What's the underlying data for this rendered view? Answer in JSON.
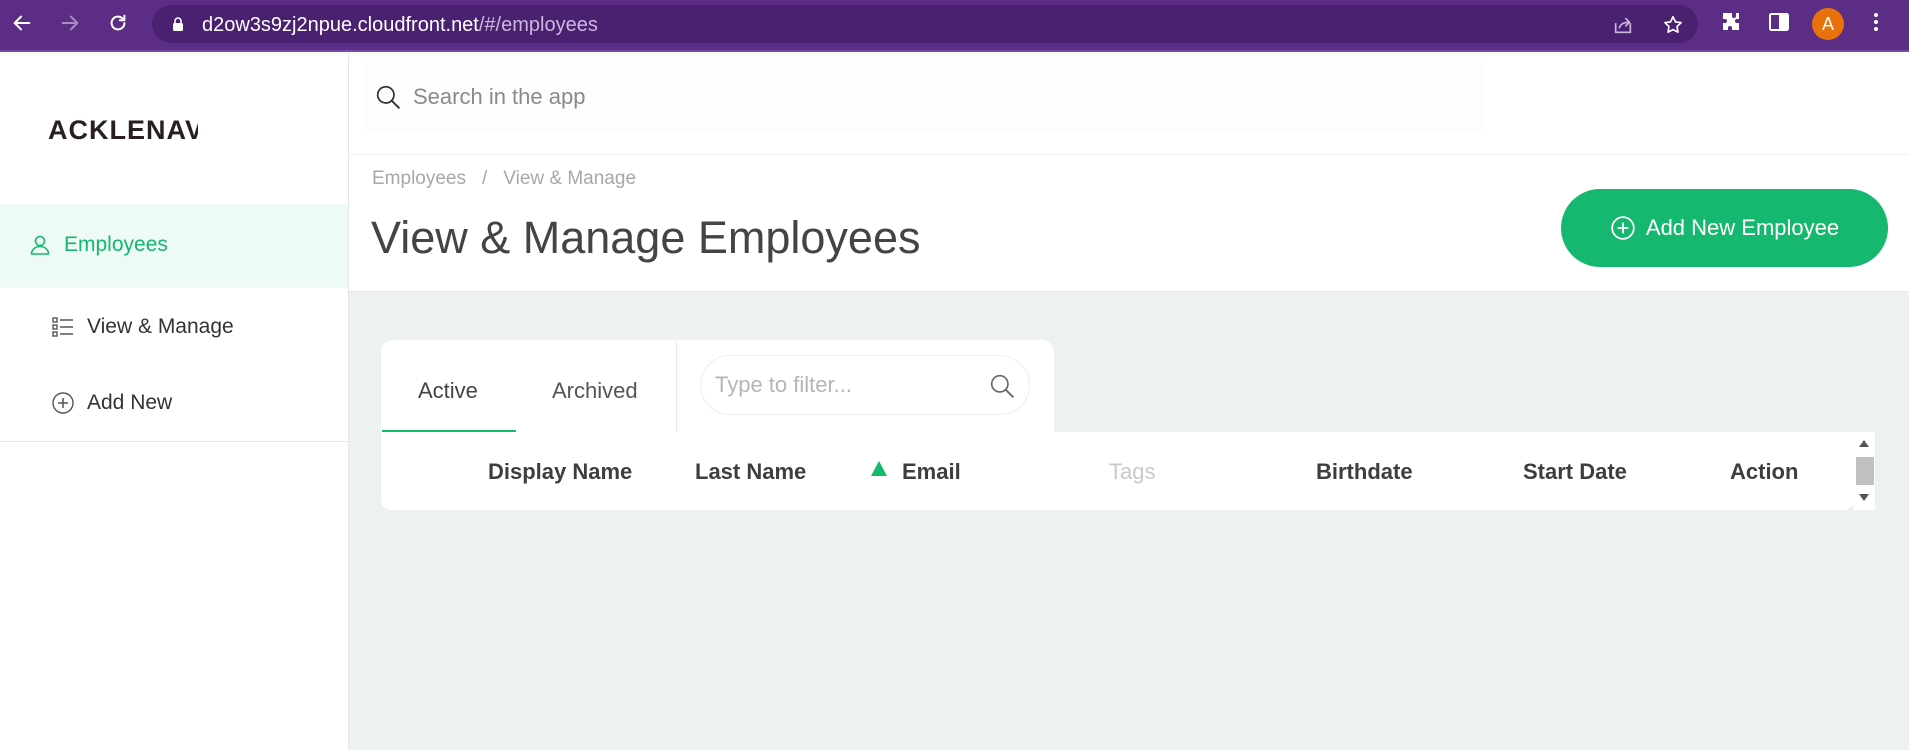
{
  "browser": {
    "url_host": "d2ow3s9zj2npue.cloudfront.net",
    "url_path": "/#/employees",
    "avatar_letter": "A",
    "accent_color": "#5c2d84"
  },
  "sidebar": {
    "logo": "ACKLENAV",
    "section_label": "Employees",
    "items": [
      {
        "label": "View & Manage",
        "icon": "list-icon"
      },
      {
        "label": "Add New",
        "icon": "plus-circle-icon"
      }
    ]
  },
  "search": {
    "placeholder": "Search in the app"
  },
  "breadcrumb": {
    "items": [
      "Employees",
      "/",
      "View & Manage"
    ]
  },
  "page": {
    "title": "View & Manage Employees",
    "add_button_label": "Add New Employee",
    "brand_color": "#16b76e"
  },
  "tabs": [
    {
      "label": "Active",
      "selected": true
    },
    {
      "label": "Archived",
      "selected": false
    }
  ],
  "filter": {
    "placeholder": "Type to filter..."
  },
  "table": {
    "columns": [
      "Display Name",
      "Last Name",
      "Email",
      "Tags",
      "Birthdate",
      "Start Date",
      "Action"
    ],
    "sorted_column": "Email",
    "sort_direction": "ascending"
  }
}
